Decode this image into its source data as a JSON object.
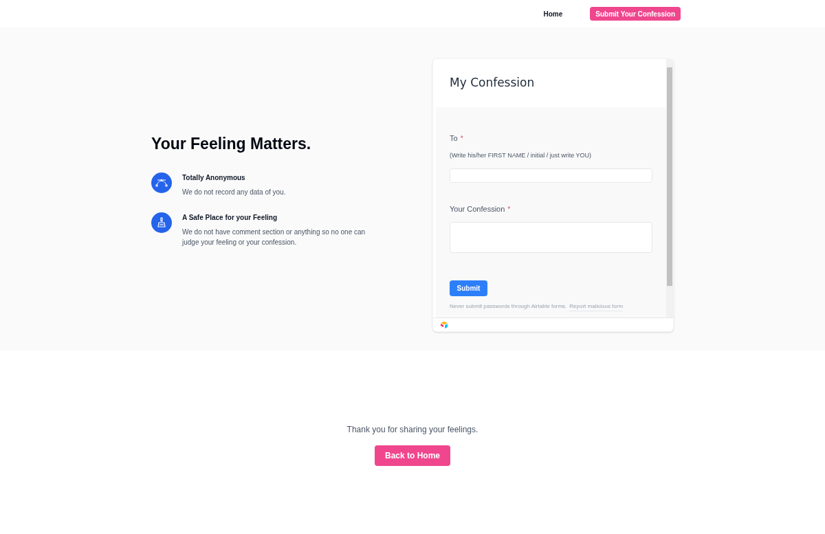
{
  "nav": {
    "links": [
      {
        "label": "Home"
      }
    ],
    "cta": "Submit Your Confession"
  },
  "hero": {
    "title": "Your Feeling Matters.",
    "features": [
      {
        "kind": "curve",
        "title": "Totally Anonymous",
        "text": "We do not record any data of you."
      },
      {
        "kind": "brush",
        "title": "A Safe Place for your Feeling",
        "text": "We do not have comment section or anything so no one can judge your feeling or your confession."
      }
    ]
  },
  "form": {
    "title": "My Confession",
    "fields": [
      {
        "kind": "line",
        "label": "To",
        "required_mark": "*",
        "hint": "(Write his/her FIRST NAME / initial / just write YOU)"
      },
      {
        "kind": "area",
        "label": "Your Confession",
        "required_mark": "*"
      }
    ],
    "submit": "Submit",
    "notice": "Never submit passwords through Airtable forms.",
    "report": "Report malicious form"
  },
  "footer": {
    "message": "Thank you for sharing your feelings.",
    "button": "Back to Home"
  }
}
